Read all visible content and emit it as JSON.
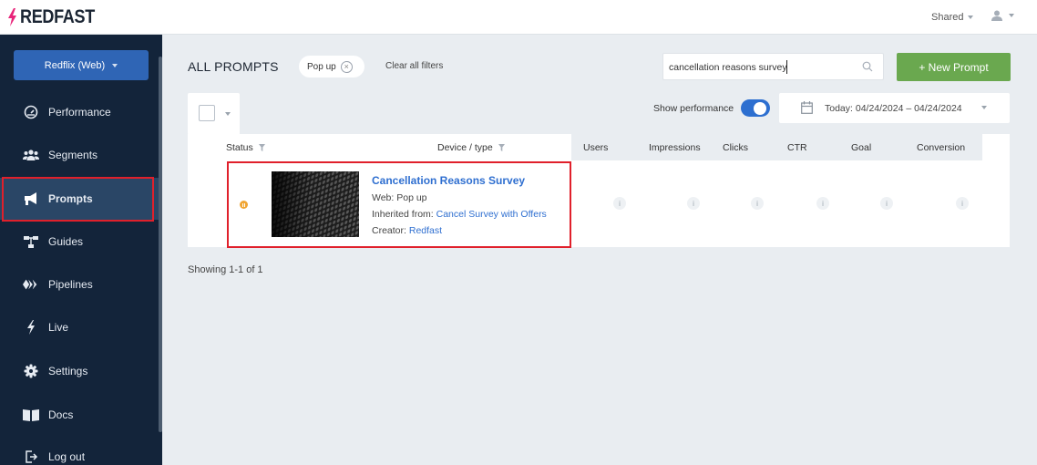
{
  "topbar": {
    "logo_text": "REDFAST",
    "shared_label": "Shared"
  },
  "sidebar": {
    "app_selector": "Redflix (Web)",
    "items": [
      {
        "label": "Performance",
        "icon": "gauge-icon"
      },
      {
        "label": "Segments",
        "icon": "users-icon"
      },
      {
        "label": "Prompts",
        "icon": "megaphone-icon",
        "active": true
      },
      {
        "label": "Guides",
        "icon": "sitemap-icon"
      },
      {
        "label": "Pipelines",
        "icon": "pipelines-icon"
      },
      {
        "label": "Live",
        "icon": "bolt-icon"
      },
      {
        "label": "Settings",
        "icon": "gear-icon"
      },
      {
        "label": "Docs",
        "icon": "book-icon"
      },
      {
        "label": "Log out",
        "icon": "logout-icon"
      }
    ]
  },
  "main": {
    "title": "ALL PROMPTS",
    "filter_chip": "Pop up",
    "clear_filters": "Clear all filters",
    "search": {
      "value": "cancellation reasons survey"
    },
    "new_prompt_button": "+ New Prompt",
    "show_performance_label": "Show performance",
    "show_performance_on": true,
    "date_range": "Today: 04/24/2024 – 04/24/2024",
    "table": {
      "columns": [
        "Status",
        "Device / type",
        "Users",
        "Impressions",
        "Clicks",
        "CTR",
        "Goal",
        "Conversion"
      ],
      "rows": [
        {
          "status": "paused",
          "name": "Cancellation Reasons Survey",
          "type": "Web: Pop up",
          "inherited_label": "Inherited from: ",
          "inherited_link": "Cancel Survey with Offers",
          "creator_label": "Creator: ",
          "creator_link": "Redfast",
          "metric_icon": "i"
        }
      ]
    },
    "showing": "Showing 1-1 of 1"
  },
  "colors": {
    "sidebar_bg": "#13243a",
    "accent_blue": "#2f6fd0",
    "new_prompt_green": "#6aa84f",
    "highlight_red": "#e0202b",
    "status_paused": "#f0a533",
    "logo_pink": "#e8247a"
  }
}
